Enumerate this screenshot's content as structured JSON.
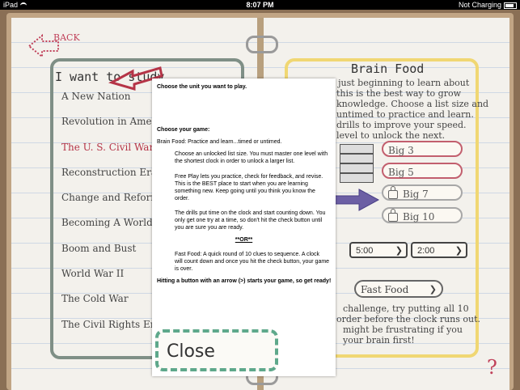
{
  "statusbar": {
    "device": "iPad",
    "time": "8:07 PM",
    "charging": "Not Charging"
  },
  "back": {
    "label": "BACK"
  },
  "unit_panel": {
    "heading": "I want to study",
    "items": [
      {
        "label": "A New Nation"
      },
      {
        "label": "Revolution in America"
      },
      {
        "label": "The U. S. Civil War",
        "selected": true
      },
      {
        "label": "Reconstruction Era"
      },
      {
        "label": "Change and Reform"
      },
      {
        "label": "Becoming A World Power"
      },
      {
        "label": "Boom and Bust"
      },
      {
        "label": "World War II"
      },
      {
        "label": "The Cold War"
      },
      {
        "label": "The Civil Rights Era"
      }
    ]
  },
  "brain_food": {
    "title": "Brain Food",
    "lines": [
      "If you're just beginning to learn about",
      "this is the best way to grow",
      "knowledge. Choose a list size and",
      "untimed to practice and learn.",
      "drills to improve your speed.",
      "level to unlock the next."
    ],
    "lists": [
      {
        "label": "Big 3",
        "locked": false
      },
      {
        "label": "Big 5",
        "locked": false
      },
      {
        "label": "Big 7",
        "locked": true
      },
      {
        "label": "Big 10",
        "locked": true
      }
    ],
    "times": [
      "5:00",
      "2:00"
    ],
    "fast_food": "Fast Food",
    "fast_lines": [
      "challenge, try putting all 10",
      "order before the clock runs out.",
      "might be frustrating if you",
      "your brain first!"
    ]
  },
  "overlay": {
    "choose_unit": "Choose the unit you want to play.",
    "choose_game": "Choose your game:",
    "brain_food": "Brain Food:  Practice and learn...timed or untimed.",
    "para1": [
      "Choose an unlocked list size.  You must master one level with",
      "the shortest clock in order to unlock a larger list."
    ],
    "para2": [
      "Free Play lets you practice, check for feedback, and revise.",
      "This is the BEST place to start when you are learning",
      "something new.  Keep going until you think you know the",
      "order."
    ],
    "para3": [
      "The drills put time on the clock and start counting down.  You",
      "only get one try at a time, so don't hit the check button until",
      "you are sure you are ready."
    ],
    "or": "**OR**",
    "fast_food": [
      "Fast Food:  A quick round of 10 clues to sequence.  A clock",
      "will count down and once you hit the check button, your game",
      "is over."
    ],
    "hint": "Hitting a button with an arrow (>) starts your game, so get ready!"
  },
  "close": {
    "label": "Close"
  },
  "help": {
    "label": "?"
  }
}
